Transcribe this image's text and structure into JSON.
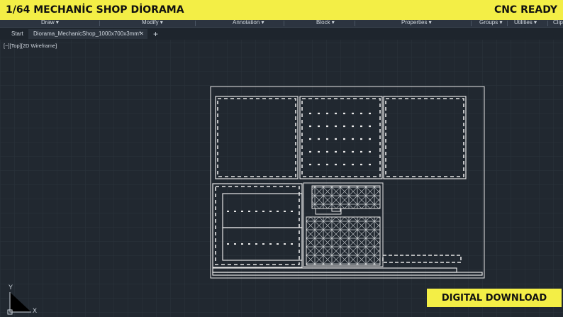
{
  "banner": {
    "title": "1/64 MECHANİC SHOP DİORAMA",
    "badge": "CNC READY"
  },
  "menu": {
    "draw": "Draw ▾",
    "modify": "Modify ▾",
    "annotation": "Annotation ▾",
    "block": "Block ▾",
    "properties": "Properties ▾",
    "groups": "Groups ▾",
    "utilities": "Utilities ▾",
    "clip": "Clip"
  },
  "tabs": {
    "start": "Start",
    "file": "Diorama_MechanicShop_1000x700x3mm*",
    "close": "✕",
    "add": "+"
  },
  "viewport": {
    "label": "[−][Top][2D Wireframe]"
  },
  "ucs": {
    "y": "Y",
    "x": "X"
  },
  "footer": {
    "download": "DIGITAL DOWNLOAD"
  },
  "colors": {
    "accent": "#f3ee46",
    "background": "#212830",
    "lines": "#e6e6e6"
  }
}
